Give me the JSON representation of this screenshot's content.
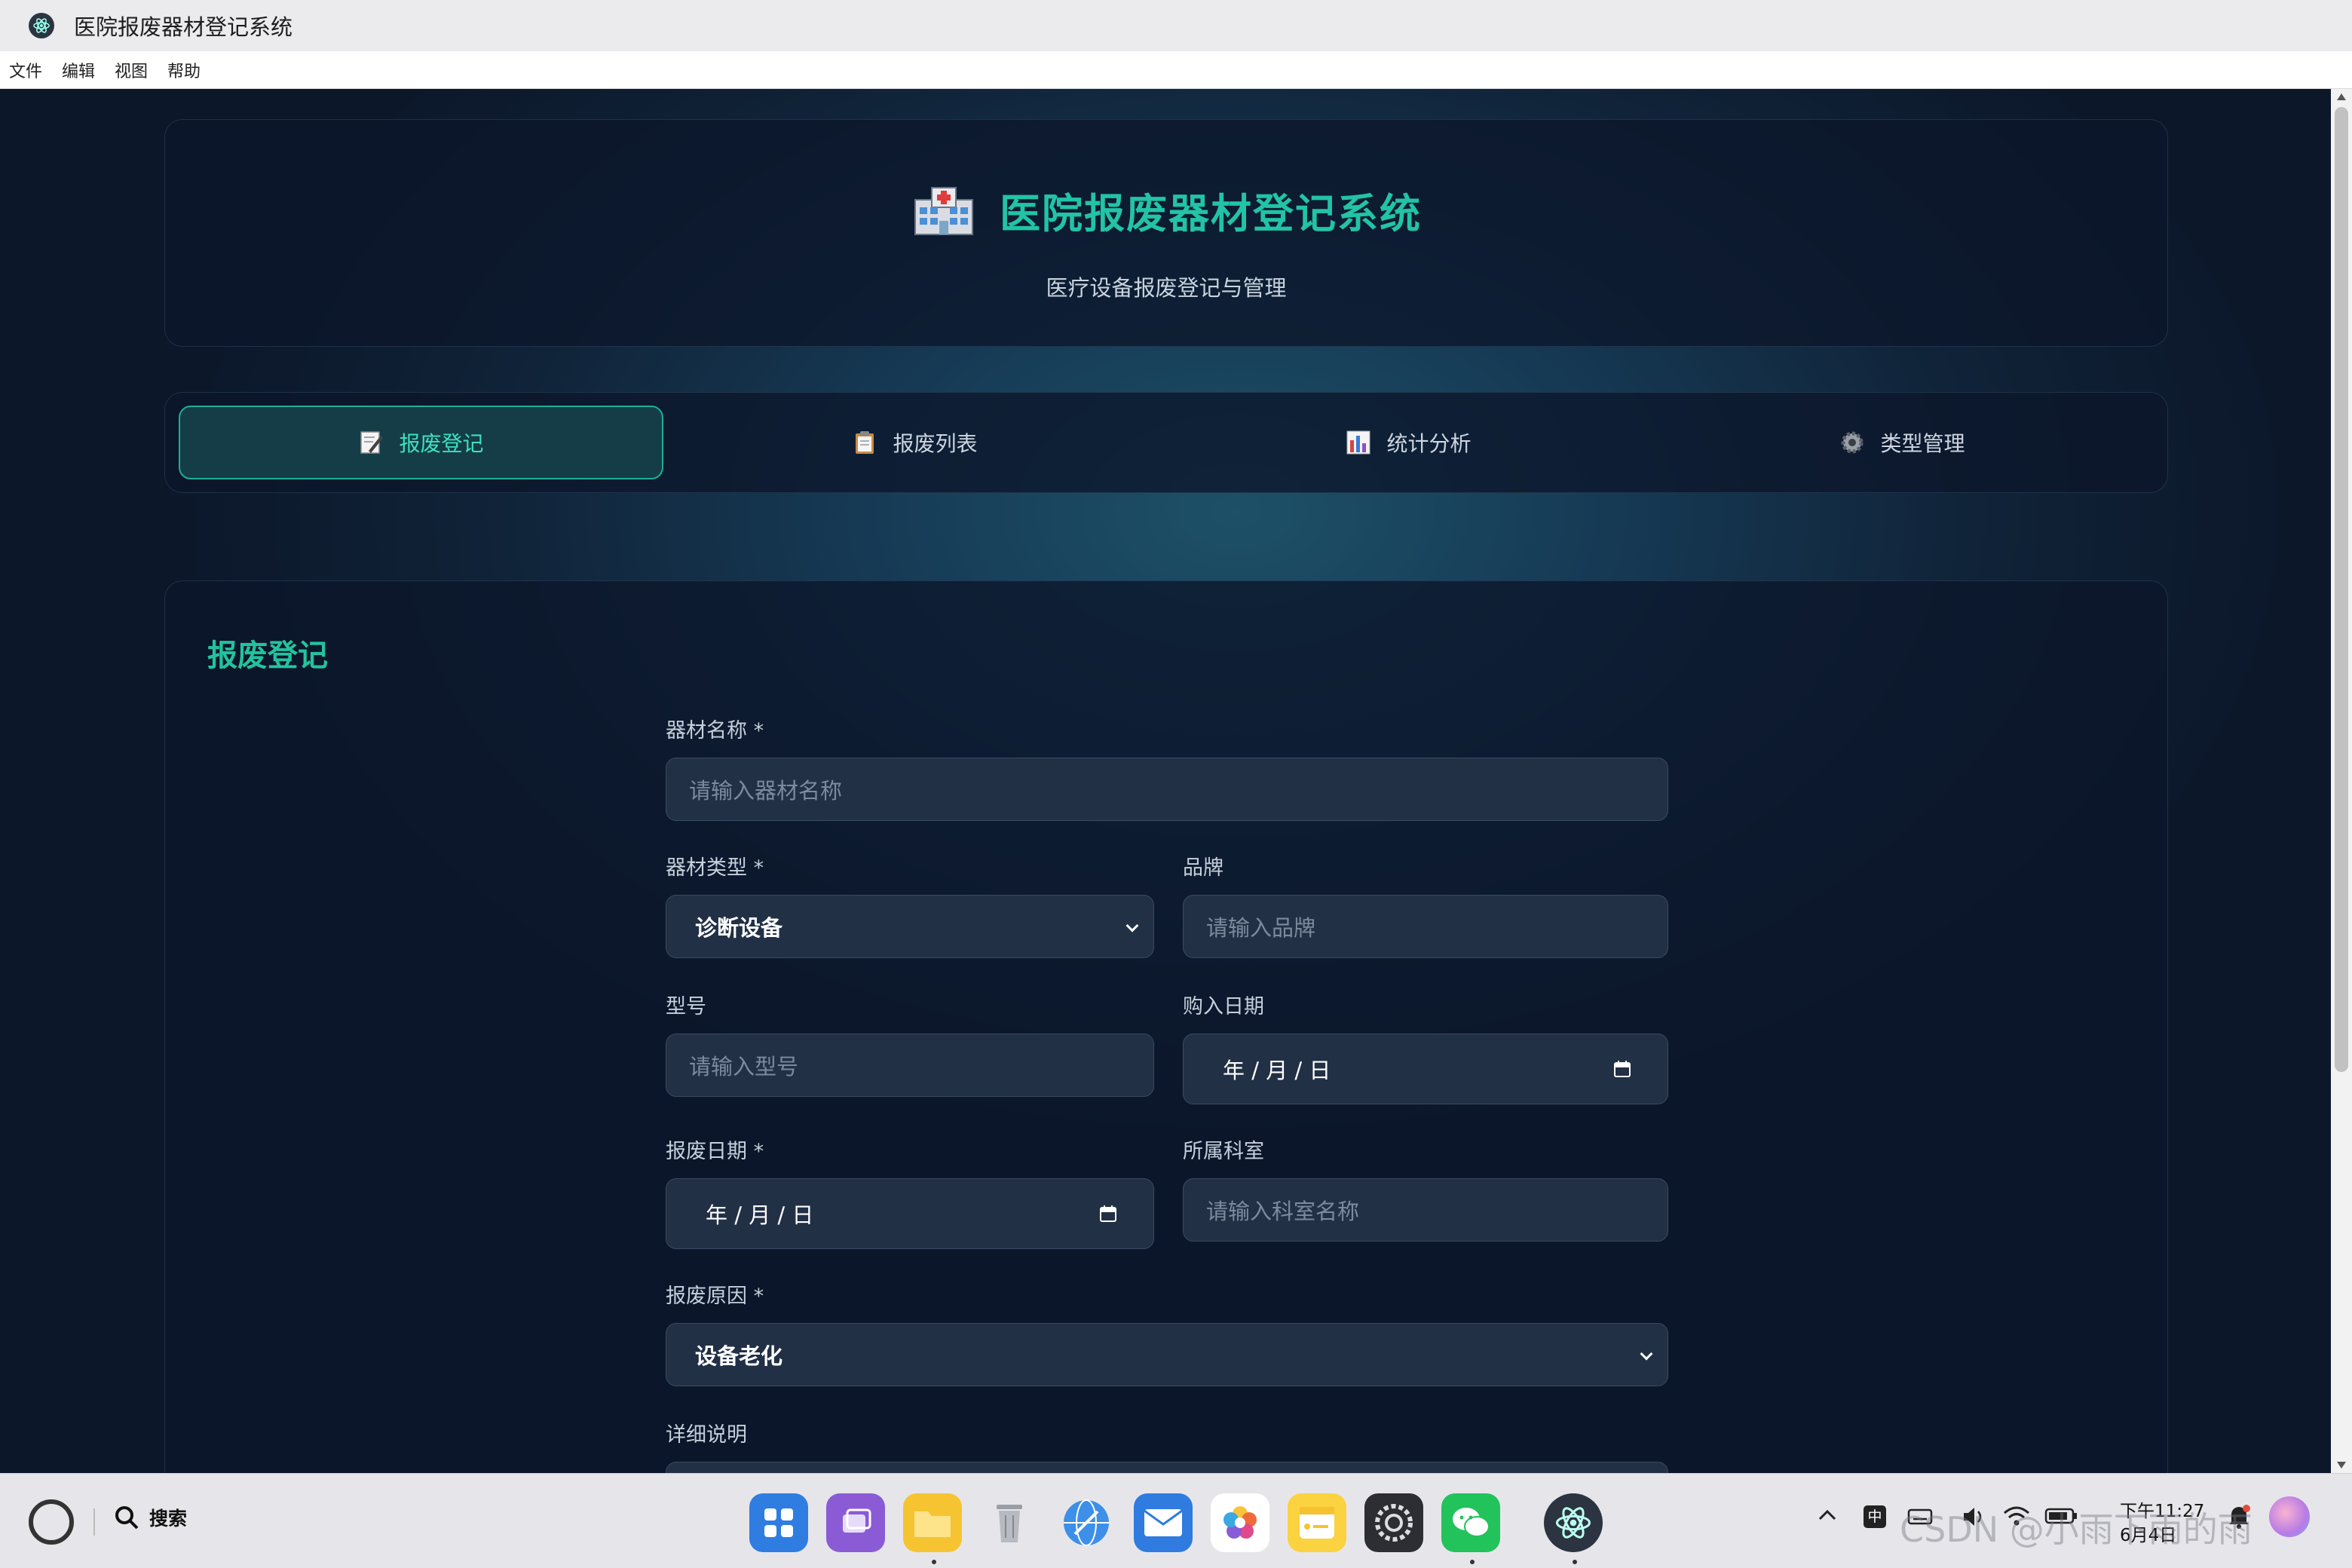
{
  "window": {
    "title": "医院报废器材登记系统"
  },
  "menu": [
    "文件",
    "编辑",
    "视图",
    "帮助"
  ],
  "header": {
    "title": "医院报废器材登记系统",
    "subtitle": "医疗设备报废登记与管理"
  },
  "tabs": [
    {
      "label": "报废登记",
      "icon": "memo-icon",
      "active": true
    },
    {
      "label": "报废列表",
      "icon": "clipboard-icon",
      "active": false
    },
    {
      "label": "统计分析",
      "icon": "bar-chart-icon",
      "active": false
    },
    {
      "label": "类型管理",
      "icon": "gear-icon",
      "active": false
    }
  ],
  "form": {
    "title": "报废登记",
    "name": {
      "label": "器材名称 *",
      "placeholder": "请输入器材名称"
    },
    "type": {
      "label": "器材类型 *",
      "value": "诊断设备"
    },
    "brand": {
      "label": "品牌",
      "placeholder": "请输入品牌"
    },
    "model": {
      "label": "型号",
      "placeholder": "请输入型号"
    },
    "purchase_date": {
      "label": "购入日期",
      "value": "年   / 月 / 日"
    },
    "scrap_date": {
      "label": "报废日期 *",
      "value": "年   / 月 / 日"
    },
    "department": {
      "label": "所属科室",
      "placeholder": "请输入科室名称"
    },
    "reason": {
      "label": "报废原因 *",
      "value": "设备老化"
    },
    "details": {
      "label": "详细说明"
    }
  },
  "taskbar": {
    "search_label": "搜索",
    "ime": "中",
    "time": "下午11:27",
    "date": "6月4日",
    "watermark": "CSDN @小雨下雨的雨"
  },
  "colors": {
    "accent": "#22c3a6",
    "active_tab_bg": "#143d48",
    "field_bg": "#223046"
  }
}
